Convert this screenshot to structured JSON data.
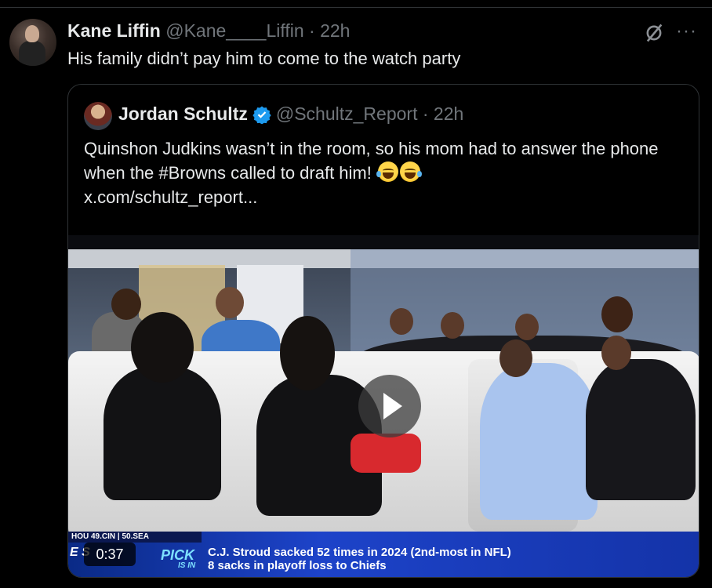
{
  "tweet": {
    "name": "Kane Liffin",
    "handle": "@Kane____Liffin",
    "time": "· 22h",
    "text": "His family didn’t pay him to come to the watch party",
    "more_label": "···"
  },
  "quote": {
    "name": "Jordan Schultz",
    "handle": "@Schultz_Report",
    "time": "· 22h",
    "text": "Quinshon Judkins wasn’t in the room, so his mom had to answer the phone when the #Browns called to draft him!",
    "link": "x.com/schultz_report...",
    "verified_color": "#1d9bf0"
  },
  "video": {
    "duration": "0:37",
    "ticker_top": "HOU   49.CIN  |  50.SEA",
    "pick_label": "PICK",
    "is_in_label": "IS IN",
    "logo_fragment": "E  S",
    "headline_line1": "C.J. Stroud sacked 52 times in 2024 (2nd-most in NFL)",
    "headline_line2": "8 sacks in playoff loss to Chiefs"
  }
}
